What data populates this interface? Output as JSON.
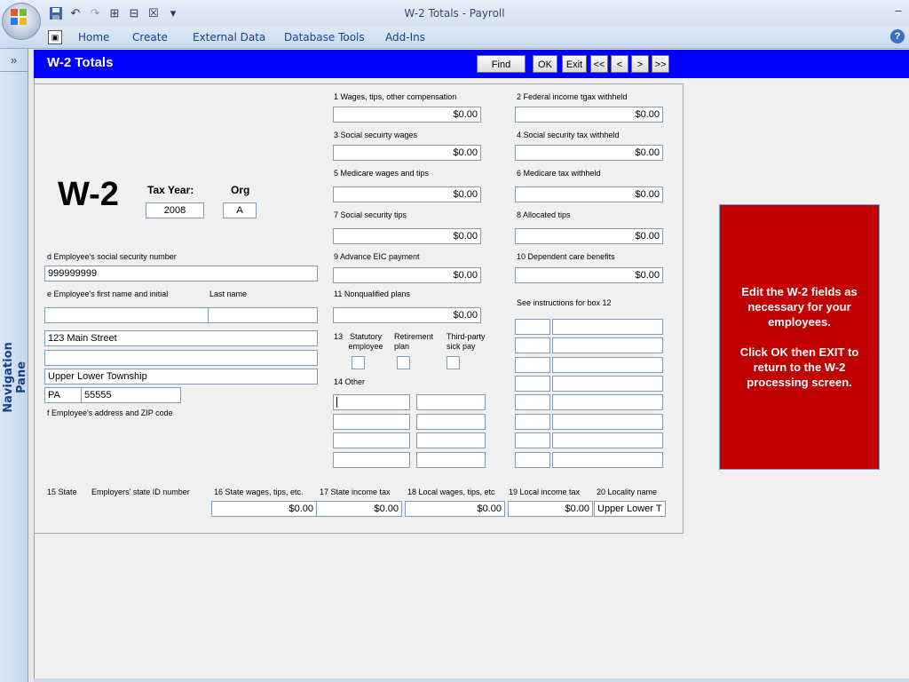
{
  "window": {
    "title": "W-2 Totals - Payroll",
    "minimize": "–"
  },
  "qat": {
    "icons": [
      "save-icon",
      "undo-icon",
      "redo-icon",
      "relationships-icon",
      "dependencies-icon",
      "close-doc-icon",
      "customize-icon"
    ]
  },
  "ribbon": {
    "tab_icon": "▣",
    "tabs": [
      "Home",
      "Create",
      "External Data",
      "Database Tools",
      "Add-Ins"
    ],
    "help": "?"
  },
  "nav": {
    "toggle": "»",
    "label": "Navigation Pane"
  },
  "form": {
    "title": "W-2 Totals",
    "buttons": {
      "find": "Find",
      "ok": "OK",
      "exit": "Exit",
      "first": "<<",
      "prev": "<",
      "next": ">",
      "last": ">>"
    }
  },
  "w2": {
    "big_label": "W-2",
    "tax_year_label": "Tax Year:",
    "tax_year": "2008",
    "org_label": "Org",
    "org": "A",
    "ssn_label": "d  Employee's social security number",
    "ssn": "999999999",
    "first_name_label": "e  Employee's first name and initial",
    "last_name_label": "Last name",
    "first_name": "",
    "last_name": "",
    "address1": "123 Main Street",
    "address2": "",
    "city": "Upper Lower Township",
    "state": "PA",
    "zip": "55555",
    "address_label": "f  Employee's address and ZIP code",
    "box1_label": "1  Wages, tips, other compensation",
    "box1": "$0.00",
    "box2_label": "2  Federal income tgax withheld",
    "box2": "$0.00",
    "box3_label": "3  Social secuirty wages",
    "box3": "$0.00",
    "box4_label": "4  Social security tax withheld",
    "box4": "$0.00",
    "box5_label": "5  Medicare wages and tips",
    "box5": "$0.00",
    "box6_label": "6  Medicare tax withheld",
    "box6": "$0.00",
    "box7_label": "7  Social security tips",
    "box7": "$0.00",
    "box8_label": "8  Allocated tips",
    "box8": "$0.00",
    "box9_label": "9  Advance EIC payment",
    "box9": "$0.00",
    "box10_label": "10  Dependent care benefits",
    "box10": "$0.00",
    "box11_label": "11  Nonqualified plans",
    "box11": "$0.00",
    "box12_label": "See instructions for box 12",
    "box13_label": "13",
    "box13_statutory": "Statutory\nemployee",
    "box13_retirement": "Retirement\nplan",
    "box13_thirdparty": "Third-party\nsick pay",
    "box14_label": "14 Other",
    "box15_label": "15 State",
    "employer_state_id_label": "Employers' state ID number",
    "box16_label": "16 State wages, tips, etc.",
    "box16": "$0.00",
    "box17_label": "17 State income tax",
    "box17": "$0.00",
    "box18_label": "18 Local wages, tips, etc",
    "box18": "$0.00",
    "box19_label": "19 Local income tax",
    "box19": "$0.00",
    "box20_label": "20 Locality name",
    "box20": "Upper Lower T"
  },
  "note": {
    "text": "Edit the W-2 fields as necessary for your employees.\n\nClick OK then EXIT to return to the W-2 processing screen."
  }
}
